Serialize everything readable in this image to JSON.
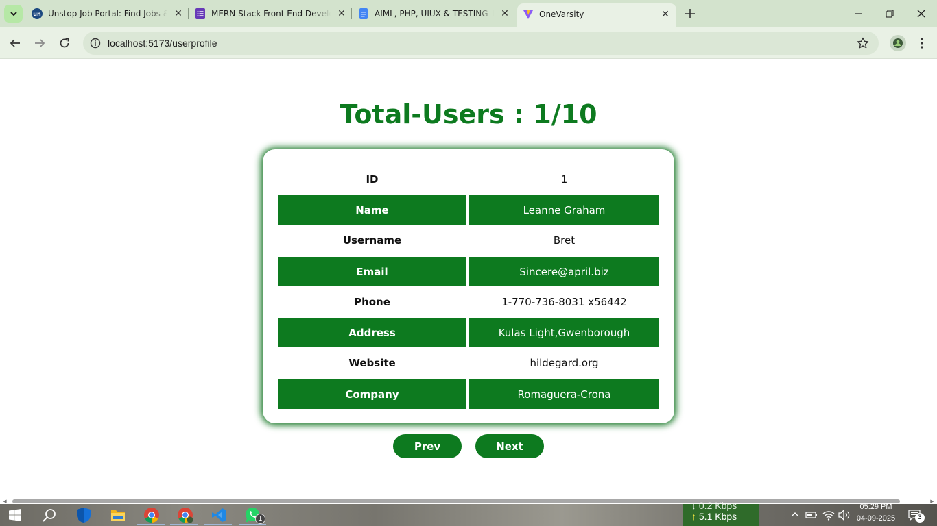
{
  "browser": {
    "tabs": [
      {
        "title": "Unstop Job Portal: Find Jobs & Internships",
        "favicon": "unstop-icon"
      },
      {
        "title": "MERN Stack Front End Developer",
        "favicon": "forms-icon"
      },
      {
        "title": "AIML, PHP, UIUX & TESTING_Interns",
        "favicon": "docs-icon"
      },
      {
        "title": "OneVarsity",
        "favicon": "vite-icon",
        "active": true
      }
    ],
    "url": "localhost:5173/userprofile"
  },
  "page": {
    "title": "Total-Users : 1/10",
    "fields": [
      {
        "label": "ID",
        "value": "1"
      },
      {
        "label": "Name",
        "value": "Leanne Graham"
      },
      {
        "label": "Username",
        "value": "Bret"
      },
      {
        "label": "Email",
        "value": "Sincere@april.biz"
      },
      {
        "label": "Phone",
        "value": "1-770-736-8031 x56442"
      },
      {
        "label": "Address",
        "value": "Kulas Light,Gwenborough"
      },
      {
        "label": "Website",
        "value": "hildegard.org"
      },
      {
        "label": "Company",
        "value": "Romaguera-Crona"
      }
    ],
    "prev_label": "Prev",
    "next_label": "Next"
  },
  "colors": {
    "accent": "#0d7a1f"
  },
  "taskbar": {
    "net_down": "0.2 Kbps",
    "net_up": "5.1 Kbps",
    "time": "05:29 PM",
    "date": "04-09-2025",
    "whatsapp_badge": "1",
    "notifications_badge": "3"
  }
}
